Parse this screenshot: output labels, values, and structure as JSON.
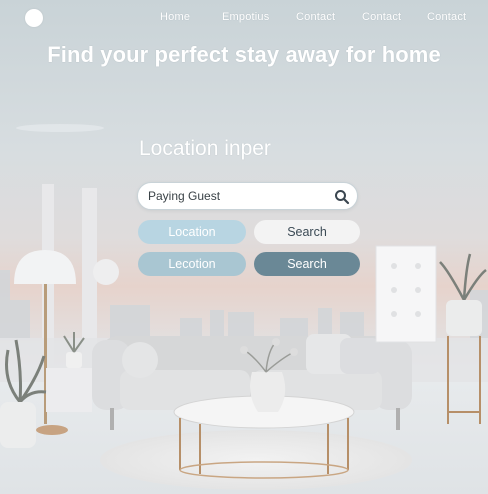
{
  "nav": {
    "items": [
      {
        "label": "Home"
      },
      {
        "label": "Empotius"
      },
      {
        "label": "Contact"
      },
      {
        "label": "Contact"
      },
      {
        "label": "Contact"
      }
    ]
  },
  "hero": {
    "headline": "Find your perfect stay away for home"
  },
  "form": {
    "section_label": "Location inper",
    "search_value": "Paying Guest",
    "row1": {
      "location_label": "Location",
      "search_label": "Search"
    },
    "row2": {
      "location_label": "Lecotion",
      "search_label": "Search"
    }
  },
  "icons": {
    "logo": "circle-logo-icon",
    "search": "search-icon"
  },
  "colors": {
    "accent_light": "#b8d5e2",
    "accent_mid": "#a9c6d2",
    "accent_dark": "#6a8896",
    "text_light": "#ffffff"
  }
}
